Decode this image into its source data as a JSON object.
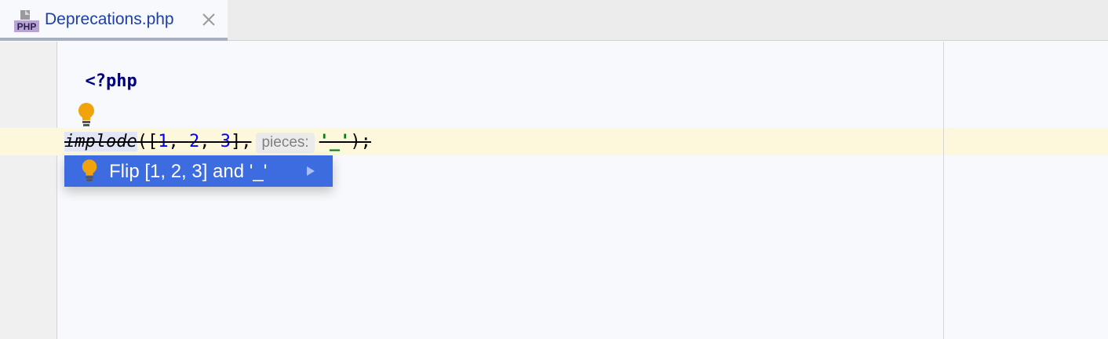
{
  "tab": {
    "filename": "Deprecations.php",
    "icon": "php-file-icon",
    "icon_text": "PHP"
  },
  "code": {
    "line1": "<?php",
    "line3": {
      "function": "implode",
      "open": "([",
      "n1": "1",
      "sep1": ", ",
      "n2": "2",
      "sep2": ", ",
      "n3": "3",
      "close_arr": "],",
      "hint": "pieces:",
      "str": "'_'",
      "close": ");"
    }
  },
  "intention_popup": {
    "label": "Flip [1, 2, 3] and '_'"
  },
  "colors": {
    "accent": "#3d6ce0",
    "keyword": "#000080",
    "number": "#0000ff",
    "string": "#067d17",
    "bulb": "#f0a30a"
  }
}
